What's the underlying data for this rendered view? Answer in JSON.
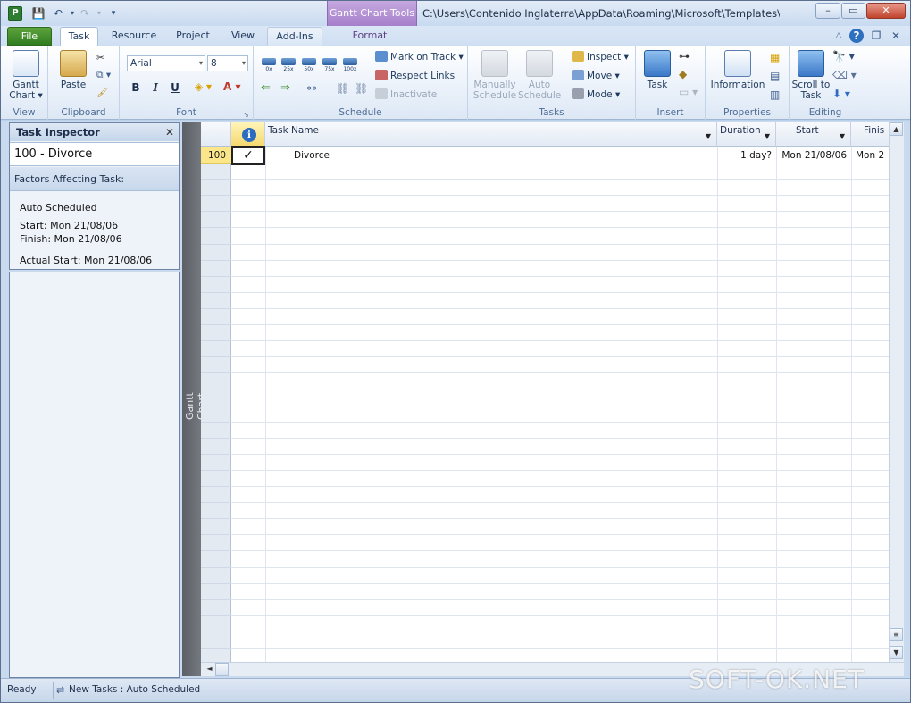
{
  "titlebar": {
    "app_icon_letter": "P",
    "context_tab_title": "Gantt Chart Tools",
    "path": "C:\\Users\\Contenido Inglaterra\\AppData\\Roaming\\Microsoft\\Templates\\ASG_We...",
    "minimize": "–",
    "restore": "▭",
    "close": "✕"
  },
  "tabs": {
    "file": "File",
    "task": "Task",
    "resource": "Resource",
    "project": "Project",
    "view": "View",
    "addins": "Add-Ins",
    "format": "Format"
  },
  "ribbon": {
    "view_group": {
      "label": "View",
      "gantt_chart": "Gantt Chart ▾"
    },
    "clipboard_group": {
      "label": "Clipboard",
      "paste": "Paste"
    },
    "font_group": {
      "label": "Font",
      "font_name": "Arial",
      "font_size": "8",
      "bold": "B",
      "italic": "I",
      "underline": "U"
    },
    "schedule_group": {
      "label": "Schedule",
      "percent_buttons": [
        "0x",
        "25x",
        "50x",
        "75x",
        "100x"
      ],
      "mark_on_track": "Mark on Track",
      "respect_links": "Respect Links",
      "inactivate": "Inactivate"
    },
    "tasks_group": {
      "label": "Tasks",
      "manually_schedule": "Manually Schedule",
      "auto_schedule": "Auto Schedule",
      "inspect": "Inspect",
      "move": "Move",
      "mode": "Mode"
    },
    "insert_group": {
      "label": "Insert",
      "task": "Task"
    },
    "properties_group": {
      "label": "Properties",
      "information": "Information"
    },
    "editing_group": {
      "label": "Editing",
      "scroll_to_task": "Scroll to Task"
    }
  },
  "task_inspector": {
    "title": "Task Inspector",
    "task_heading": "100 - Divorce",
    "factors_heading": "Factors Affecting Task:",
    "mode": "Auto Scheduled",
    "start": "Start: Mon 21/08/06",
    "finish": "Finish: Mon 21/08/06",
    "actual_start": "Actual Start: Mon 21/08/06"
  },
  "view_bar_label": "Gantt Chart",
  "grid": {
    "columns": {
      "task_name": "Task Name",
      "duration": "Duration",
      "start": "Start",
      "finish": "Finis"
    },
    "indicator_symbol": "i",
    "rows": [
      {
        "id": "100",
        "check": "✓",
        "name": "Divorce",
        "duration": "1 day?",
        "start": "Mon 21/08/06",
        "finish": "Mon 2"
      }
    ]
  },
  "status": {
    "ready": "Ready",
    "new_tasks": "New Tasks : Auto Scheduled"
  },
  "watermark": "SOFT-OK.NET",
  "colors": {
    "file_tab": "#2f7d1f",
    "context_tab": "#a67fcb",
    "row_highlight": "#fbe78a"
  }
}
